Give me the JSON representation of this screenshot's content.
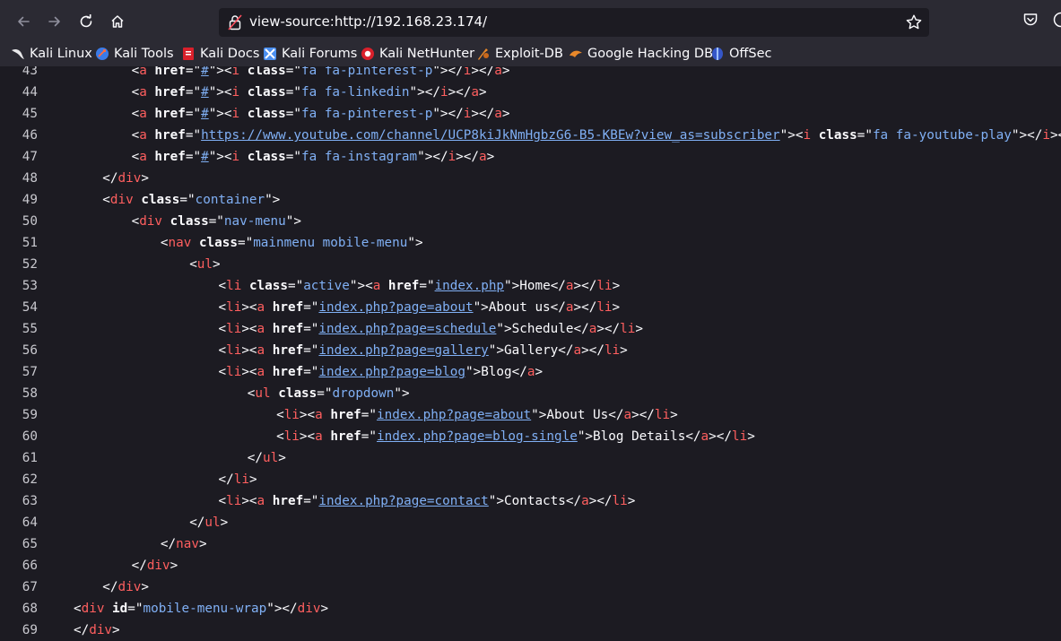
{
  "address_bar": {
    "url": "view-source:http://192.168.23.174/"
  },
  "icons": {
    "back": "arrow-left-icon",
    "forward": "arrow-right-icon",
    "reload": "reload-icon",
    "home": "home-icon",
    "lock": "insecure-lock-icon",
    "star": "star-icon",
    "pocket": "pocket-icon"
  },
  "colors": {
    "tag": "#ff5f5f",
    "attr_value": "#80b0f5",
    "background": "#1c1b22",
    "toolbar": "#2b2a33"
  },
  "bookmarks": [
    {
      "label": "Kali Linux",
      "icon": "kali-dragon-icon"
    },
    {
      "label": "Kali Tools",
      "icon": "kali-tools-icon"
    },
    {
      "label": "Kali Docs",
      "icon": "kali-docs-icon"
    },
    {
      "label": "Kali Forums",
      "icon": "kali-forums-icon"
    },
    {
      "label": "Kali NetHunter",
      "icon": "nethunter-icon"
    },
    {
      "label": "Exploit-DB",
      "icon": "exploit-db-icon"
    },
    {
      "label": "Google Hacking DB",
      "icon": "ghdb-icon"
    },
    {
      "label": "OffSec",
      "icon": "offsec-icon"
    }
  ],
  "source_lines": [
    {
      "n": "43",
      "indent": 3,
      "tokens": [
        [
          "p",
          "<"
        ],
        [
          "t",
          "a"
        ],
        [
          "p",
          " "
        ],
        [
          "a",
          "href"
        ],
        [
          "p",
          "=\""
        ],
        [
          "lk",
          "#"
        ],
        [
          "p",
          "\"><"
        ],
        [
          "t",
          "i"
        ],
        [
          "p",
          " "
        ],
        [
          "a",
          "class"
        ],
        [
          "p",
          "=\""
        ],
        [
          "v",
          "fa fa-pinterest-p"
        ],
        [
          "p",
          "\"></"
        ],
        [
          "t",
          "i"
        ],
        [
          "p",
          "></"
        ],
        [
          "t",
          "a"
        ],
        [
          "p",
          ">"
        ]
      ]
    },
    {
      "n": "44",
      "indent": 3,
      "tokens": [
        [
          "p",
          "<"
        ],
        [
          "t",
          "a"
        ],
        [
          "p",
          " "
        ],
        [
          "a",
          "href"
        ],
        [
          "p",
          "=\""
        ],
        [
          "lk",
          "#"
        ],
        [
          "p",
          "\"><"
        ],
        [
          "t",
          "i"
        ],
        [
          "p",
          " "
        ],
        [
          "a",
          "class"
        ],
        [
          "p",
          "=\""
        ],
        [
          "v",
          "fa fa-linkedin"
        ],
        [
          "p",
          "\"></"
        ],
        [
          "t",
          "i"
        ],
        [
          "p",
          "></"
        ],
        [
          "t",
          "a"
        ],
        [
          "p",
          ">"
        ]
      ]
    },
    {
      "n": "45",
      "indent": 3,
      "tokens": [
        [
          "p",
          "<"
        ],
        [
          "t",
          "a"
        ],
        [
          "p",
          " "
        ],
        [
          "a",
          "href"
        ],
        [
          "p",
          "=\""
        ],
        [
          "lk",
          "#"
        ],
        [
          "p",
          "\"><"
        ],
        [
          "t",
          "i"
        ],
        [
          "p",
          " "
        ],
        [
          "a",
          "class"
        ],
        [
          "p",
          "=\""
        ],
        [
          "v",
          "fa fa-pinterest-p"
        ],
        [
          "p",
          "\"></"
        ],
        [
          "t",
          "i"
        ],
        [
          "p",
          "></"
        ],
        [
          "t",
          "a"
        ],
        [
          "p",
          ">"
        ]
      ]
    },
    {
      "n": "46",
      "indent": 3,
      "tokens": [
        [
          "p",
          "<"
        ],
        [
          "t",
          "a"
        ],
        [
          "p",
          " "
        ],
        [
          "a",
          "href"
        ],
        [
          "p",
          "=\""
        ],
        [
          "lk",
          "https://www.youtube.com/channel/UCP8kiJkNmHgbzG6-B5-KBEw?view_as=subscriber"
        ],
        [
          "p",
          "\"><"
        ],
        [
          "t",
          "i"
        ],
        [
          "p",
          " "
        ],
        [
          "a",
          "class"
        ],
        [
          "p",
          "=\""
        ],
        [
          "v",
          "fa fa-youtube-play"
        ],
        [
          "p",
          "\"></"
        ],
        [
          "t",
          "i"
        ],
        [
          "p",
          "></"
        ],
        [
          "t",
          "a"
        ],
        [
          "p",
          ">"
        ]
      ]
    },
    {
      "n": "47",
      "indent": 3,
      "tokens": [
        [
          "p",
          "<"
        ],
        [
          "t",
          "a"
        ],
        [
          "p",
          " "
        ],
        [
          "a",
          "href"
        ],
        [
          "p",
          "=\""
        ],
        [
          "lk",
          "#"
        ],
        [
          "p",
          "\"><"
        ],
        [
          "t",
          "i"
        ],
        [
          "p",
          " "
        ],
        [
          "a",
          "class"
        ],
        [
          "p",
          "=\""
        ],
        [
          "v",
          "fa fa-instagram"
        ],
        [
          "p",
          "\"></"
        ],
        [
          "t",
          "i"
        ],
        [
          "p",
          "></"
        ],
        [
          "t",
          "a"
        ],
        [
          "p",
          ">"
        ]
      ]
    },
    {
      "n": "48",
      "indent": 2,
      "tokens": [
        [
          "p",
          "</"
        ],
        [
          "t",
          "div"
        ],
        [
          "p",
          ">"
        ]
      ]
    },
    {
      "n": "49",
      "indent": 2,
      "tokens": [
        [
          "p",
          "<"
        ],
        [
          "t",
          "div"
        ],
        [
          "p",
          " "
        ],
        [
          "a",
          "class"
        ],
        [
          "p",
          "=\""
        ],
        [
          "v",
          "container"
        ],
        [
          "p",
          "\">"
        ]
      ]
    },
    {
      "n": "50",
      "indent": 3,
      "tokens": [
        [
          "p",
          "<"
        ],
        [
          "t",
          "div"
        ],
        [
          "p",
          " "
        ],
        [
          "a",
          "class"
        ],
        [
          "p",
          "=\""
        ],
        [
          "v",
          "nav-menu"
        ],
        [
          "p",
          "\">"
        ]
      ]
    },
    {
      "n": "51",
      "indent": 4,
      "tokens": [
        [
          "p",
          "<"
        ],
        [
          "t",
          "nav"
        ],
        [
          "p",
          " "
        ],
        [
          "a",
          "class"
        ],
        [
          "p",
          "=\""
        ],
        [
          "v",
          "mainmenu mobile-menu"
        ],
        [
          "p",
          "\">"
        ]
      ]
    },
    {
      "n": "52",
      "indent": 5,
      "tokens": [
        [
          "p",
          "<"
        ],
        [
          "t",
          "ul"
        ],
        [
          "p",
          ">"
        ]
      ]
    },
    {
      "n": "53",
      "indent": 6,
      "tokens": [
        [
          "p",
          "<"
        ],
        [
          "t",
          "li"
        ],
        [
          "p",
          " "
        ],
        [
          "a",
          "class"
        ],
        [
          "p",
          "=\""
        ],
        [
          "v",
          "active"
        ],
        [
          "p",
          "\"><"
        ],
        [
          "t",
          "a"
        ],
        [
          "p",
          " "
        ],
        [
          "a",
          "href"
        ],
        [
          "p",
          "=\""
        ],
        [
          "lk",
          "index.php"
        ],
        [
          "p",
          "\">"
        ],
        [
          "txt",
          "Home"
        ],
        [
          "p",
          "</"
        ],
        [
          "t",
          "a"
        ],
        [
          "p",
          "></"
        ],
        [
          "t",
          "li"
        ],
        [
          "p",
          ">"
        ]
      ]
    },
    {
      "n": "54",
      "indent": 6,
      "tokens": [
        [
          "p",
          "<"
        ],
        [
          "t",
          "li"
        ],
        [
          "p",
          "><"
        ],
        [
          "t",
          "a"
        ],
        [
          "p",
          " "
        ],
        [
          "a",
          "href"
        ],
        [
          "p",
          "=\""
        ],
        [
          "lk",
          "index.php?page=about"
        ],
        [
          "p",
          "\">"
        ],
        [
          "txt",
          "About us"
        ],
        [
          "p",
          "</"
        ],
        [
          "t",
          "a"
        ],
        [
          "p",
          "></"
        ],
        [
          "t",
          "li"
        ],
        [
          "p",
          ">"
        ]
      ]
    },
    {
      "n": "55",
      "indent": 6,
      "tokens": [
        [
          "p",
          "<"
        ],
        [
          "t",
          "li"
        ],
        [
          "p",
          "><"
        ],
        [
          "t",
          "a"
        ],
        [
          "p",
          " "
        ],
        [
          "a",
          "href"
        ],
        [
          "p",
          "=\""
        ],
        [
          "lk",
          "index.php?page=schedule"
        ],
        [
          "p",
          "\">"
        ],
        [
          "txt",
          "Schedule"
        ],
        [
          "p",
          "</"
        ],
        [
          "t",
          "a"
        ],
        [
          "p",
          "></"
        ],
        [
          "t",
          "li"
        ],
        [
          "p",
          ">"
        ]
      ]
    },
    {
      "n": "56",
      "indent": 6,
      "tokens": [
        [
          "p",
          "<"
        ],
        [
          "t",
          "li"
        ],
        [
          "p",
          "><"
        ],
        [
          "t",
          "a"
        ],
        [
          "p",
          " "
        ],
        [
          "a",
          "href"
        ],
        [
          "p",
          "=\""
        ],
        [
          "lk",
          "index.php?page=gallery"
        ],
        [
          "p",
          "\">"
        ],
        [
          "txt",
          "Gallery"
        ],
        [
          "p",
          "</"
        ],
        [
          "t",
          "a"
        ],
        [
          "p",
          "></"
        ],
        [
          "t",
          "li"
        ],
        [
          "p",
          ">"
        ]
      ]
    },
    {
      "n": "57",
      "indent": 6,
      "tokens": [
        [
          "p",
          "<"
        ],
        [
          "t",
          "li"
        ],
        [
          "p",
          "><"
        ],
        [
          "t",
          "a"
        ],
        [
          "p",
          " "
        ],
        [
          "a",
          "href"
        ],
        [
          "p",
          "=\""
        ],
        [
          "lk",
          "index.php?page=blog"
        ],
        [
          "p",
          "\">"
        ],
        [
          "txt",
          "Blog"
        ],
        [
          "p",
          "</"
        ],
        [
          "t",
          "a"
        ],
        [
          "p",
          ">"
        ]
      ]
    },
    {
      "n": "58",
      "indent": 7,
      "tokens": [
        [
          "p",
          "<"
        ],
        [
          "t",
          "ul"
        ],
        [
          "p",
          " "
        ],
        [
          "a",
          "class"
        ],
        [
          "p",
          "=\""
        ],
        [
          "v",
          "dropdown"
        ],
        [
          "p",
          "\">"
        ]
      ]
    },
    {
      "n": "59",
      "indent": 8,
      "tokens": [
        [
          "p",
          "<"
        ],
        [
          "t",
          "li"
        ],
        [
          "p",
          "><"
        ],
        [
          "t",
          "a"
        ],
        [
          "p",
          " "
        ],
        [
          "a",
          "href"
        ],
        [
          "p",
          "=\""
        ],
        [
          "lk",
          "index.php?page=about"
        ],
        [
          "p",
          "\">"
        ],
        [
          "txt",
          "About Us"
        ],
        [
          "p",
          "</"
        ],
        [
          "t",
          "a"
        ],
        [
          "p",
          "></"
        ],
        [
          "t",
          "li"
        ],
        [
          "p",
          ">"
        ]
      ]
    },
    {
      "n": "60",
      "indent": 8,
      "tokens": [
        [
          "p",
          "<"
        ],
        [
          "t",
          "li"
        ],
        [
          "p",
          "><"
        ],
        [
          "t",
          "a"
        ],
        [
          "p",
          " "
        ],
        [
          "a",
          "href"
        ],
        [
          "p",
          "=\""
        ],
        [
          "lk",
          "index.php?page=blog-single"
        ],
        [
          "p",
          "\">"
        ],
        [
          "txt",
          "Blog Details"
        ],
        [
          "p",
          "</"
        ],
        [
          "t",
          "a"
        ],
        [
          "p",
          "></"
        ],
        [
          "t",
          "li"
        ],
        [
          "p",
          ">"
        ]
      ]
    },
    {
      "n": "61",
      "indent": 7,
      "tokens": [
        [
          "p",
          "</"
        ],
        [
          "t",
          "ul"
        ],
        [
          "p",
          ">"
        ]
      ]
    },
    {
      "n": "62",
      "indent": 6,
      "tokens": [
        [
          "p",
          "</"
        ],
        [
          "t",
          "li"
        ],
        [
          "p",
          ">"
        ]
      ]
    },
    {
      "n": "63",
      "indent": 6,
      "tokens": [
        [
          "p",
          "<"
        ],
        [
          "t",
          "li"
        ],
        [
          "p",
          "><"
        ],
        [
          "t",
          "a"
        ],
        [
          "p",
          " "
        ],
        [
          "a",
          "href"
        ],
        [
          "p",
          "=\""
        ],
        [
          "lk",
          "index.php?page=contact"
        ],
        [
          "p",
          "\">"
        ],
        [
          "txt",
          "Contacts"
        ],
        [
          "p",
          "</"
        ],
        [
          "t",
          "a"
        ],
        [
          "p",
          "></"
        ],
        [
          "t",
          "li"
        ],
        [
          "p",
          ">"
        ]
      ]
    },
    {
      "n": "64",
      "indent": 5,
      "tokens": [
        [
          "p",
          "</"
        ],
        [
          "t",
          "ul"
        ],
        [
          "p",
          ">"
        ]
      ]
    },
    {
      "n": "65",
      "indent": 4,
      "tokens": [
        [
          "p",
          "</"
        ],
        [
          "t",
          "nav"
        ],
        [
          "p",
          ">"
        ]
      ]
    },
    {
      "n": "66",
      "indent": 3,
      "tokens": [
        [
          "p",
          "</"
        ],
        [
          "t",
          "div"
        ],
        [
          "p",
          ">"
        ]
      ]
    },
    {
      "n": "67",
      "indent": 2,
      "tokens": [
        [
          "p",
          "</"
        ],
        [
          "t",
          "div"
        ],
        [
          "p",
          ">"
        ]
      ]
    },
    {
      "n": "68",
      "indent": 1,
      "tokens": [
        [
          "p",
          "<"
        ],
        [
          "t",
          "div"
        ],
        [
          "p",
          " "
        ],
        [
          "a",
          "id"
        ],
        [
          "p",
          "=\""
        ],
        [
          "v",
          "mobile-menu-wrap"
        ],
        [
          "p",
          "\"></"
        ],
        [
          "t",
          "div"
        ],
        [
          "p",
          ">"
        ]
      ]
    },
    {
      "n": "69",
      "indent": 1,
      "tokens": [
        [
          "p",
          "</"
        ],
        [
          "t",
          "div"
        ],
        [
          "p",
          ">"
        ]
      ]
    }
  ]
}
